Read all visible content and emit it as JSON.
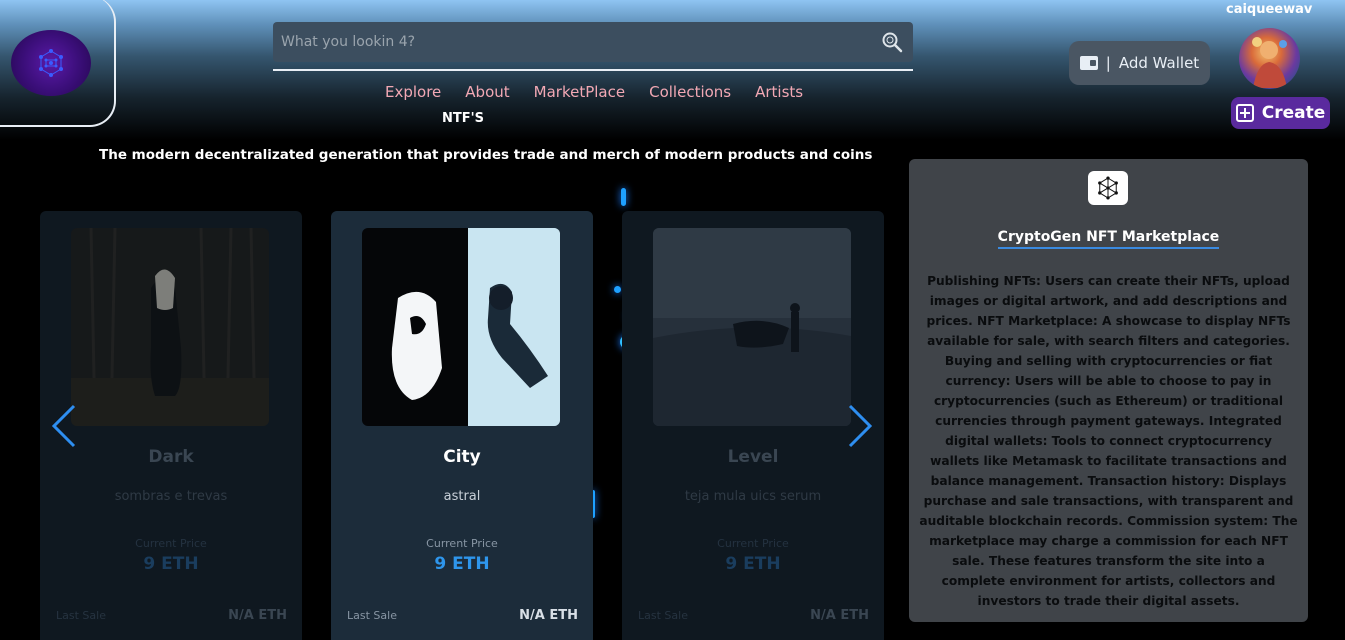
{
  "header": {
    "search_placeholder": "What you lookin 4?",
    "nav": [
      "Explore",
      "About",
      "MarketPlace",
      "Collections",
      "Artists"
    ],
    "section_label": "NTF'S",
    "tagline": "The modern decentralizated generation that provides trade and merch of modern products and coins",
    "wallet_label": "Add Wallet",
    "wallet_separator": "|",
    "username": "caiqueewav",
    "create_label": "Create"
  },
  "cards": [
    {
      "title": "Dark",
      "subtitle": "sombras e trevas",
      "price_label": "Current Price",
      "price": "9 ETH",
      "last_sale_label": "Last Sale",
      "last_sale": "N/A ETH",
      "state": "dim"
    },
    {
      "title": "City",
      "subtitle": "astral",
      "price_label": "Current Price",
      "price": "9 ETH",
      "last_sale_label": "Last Sale",
      "last_sale": "N/A ETH",
      "state": "active"
    },
    {
      "title": "Level",
      "subtitle": "teja mula uics serum",
      "price_label": "Current Price",
      "price": "9 ETH",
      "last_sale_label": "Last Sale",
      "last_sale": "N/A ETH",
      "state": "dim"
    }
  ],
  "info": {
    "title": "CryptoGen NFT Marketplace",
    "body": "Publishing NFTs: Users can create their NFTs, upload images or digital artwork, and add descriptions and prices. NFT Marketplace: A showcase to display NFTs available for sale, with search filters and categories. Buying and selling with cryptocurrencies or fiat currency: Users will be able to choose to pay in cryptocurrencies (such as Ethereum) or traditional currencies through payment gateways. Integrated digital wallets: Tools to connect cryptocurrency wallets like Metamask to facilitate transactions and balance management. Transaction history: Displays purchase and sale transactions, with transparent and auditable blockchain records. Commission system: The marketplace may charge a commission for each NFT sale. These features transform the site into a complete environment for artists, collectors and investors to trade their digital assets."
  },
  "colors": {
    "accent": "#2e96ec",
    "nav_link": "#f2a8b4",
    "create_button": "#5a2a9e",
    "panel": "#404449"
  },
  "icons": {
    "search": "search-icon",
    "wallet": "wallet-icon",
    "create": "plus-square-icon",
    "prev": "chevron-left-icon",
    "next": "chevron-right-icon",
    "logo": "hexagon-network-logo"
  }
}
